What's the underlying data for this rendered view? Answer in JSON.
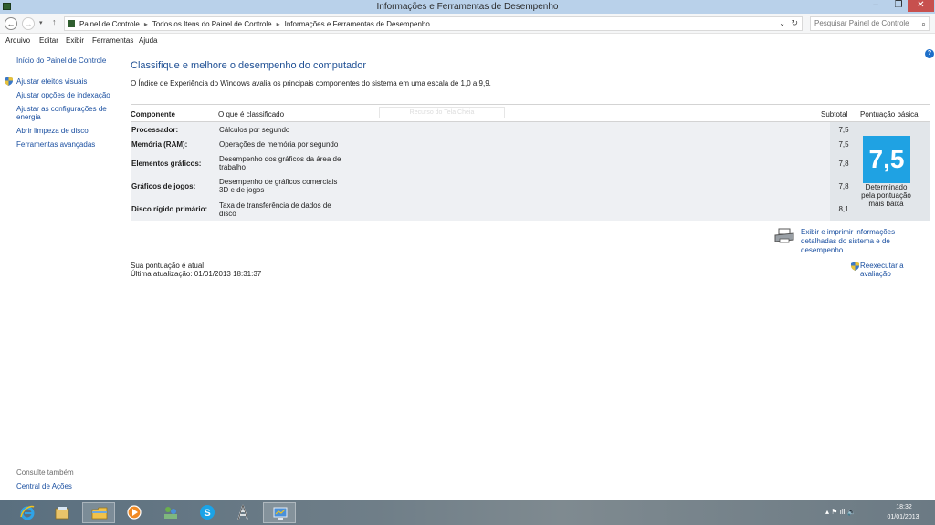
{
  "window": {
    "title": "Informações e Ferramentas de Desempenho",
    "minimize": "–",
    "maximize": "❐",
    "close": "✕"
  },
  "address": {
    "back": "←",
    "forward": "→",
    "recent": "▾",
    "up": "↑",
    "crumbs": [
      "Painel de Controle",
      "Todos os Itens do Painel de Controle",
      "Informações e Ferramentas de Desempenho"
    ],
    "separator": "▸",
    "dropdown": "⌄",
    "refresh": "↻",
    "search_placeholder": "Pesquisar Painel de Controle",
    "search_icon": "⌕"
  },
  "menu": [
    "Arquivo",
    "Editar",
    "Exibir",
    "Ferramentas",
    "Ajuda"
  ],
  "left_pane": {
    "home": "Início do Painel de Controle",
    "links": [
      "Ajustar efeitos visuais",
      "Ajustar opções de indexação",
      "Ajustar as configurações de energia",
      "Abrir limpeza de disco",
      "Ferramentas avançadas"
    ],
    "see_also_title": "Consulte também",
    "see_also_link": "Central de Ações"
  },
  "main": {
    "help": "?",
    "title": "Classifique e melhore o desempenho do computador",
    "description": "O Índice de Experiência do Windows avalia os principais componentes do sistema em uma escala de 1,0 a 9,9.",
    "ghost_button": "Recurso do Tela Cheia",
    "headers": {
      "component": "Componente",
      "what": "O que é classificado",
      "subtotal": "Subtotal",
      "base": "Pontuação básica"
    },
    "rows": [
      {
        "component": "Processador:",
        "what": "Cálculos por segundo",
        "subtotal": "7,5"
      },
      {
        "component": "Memória (RAM):",
        "what": "Operações de memória por segundo",
        "subtotal": "7,5"
      },
      {
        "component": "Elementos gráficos:",
        "what": "Desempenho dos gráficos da área de trabalho",
        "subtotal": "7,8"
      },
      {
        "component": "Gráficos de jogos:",
        "what": "Desempenho de gráficos comerciais 3D e de jogos",
        "subtotal": "7,8"
      },
      {
        "component": "Disco rígido primário:",
        "what": "Taxa de transferência de dados de disco",
        "subtotal": "8,1"
      }
    ],
    "base_score": "7,5",
    "base_caption": "Determinado pela pontuação mais baixa",
    "print_link": "Exibir e imprimir informações detalhadas do sistema e de desempenho",
    "status_current": "Sua pontuação é atual",
    "last_update": "Última atualização: 01/01/2013 18:31:37",
    "rerun": "Reexecutar a avaliação"
  },
  "taskbar": {
    "apps": [
      "internet-explorer",
      "windows-explorer-library",
      "file-explorer",
      "media-player",
      "network-people",
      "skype",
      "tower-app",
      "performance-window"
    ],
    "tray": "▴  ⚑  ıll  🔈",
    "time": "18:32",
    "date": "01/01/2013"
  },
  "colors": {
    "link": "#1a4fa0",
    "title": "#1e4f94",
    "score_tile": "#1fa2e3",
    "close_button": "#c7504e"
  }
}
